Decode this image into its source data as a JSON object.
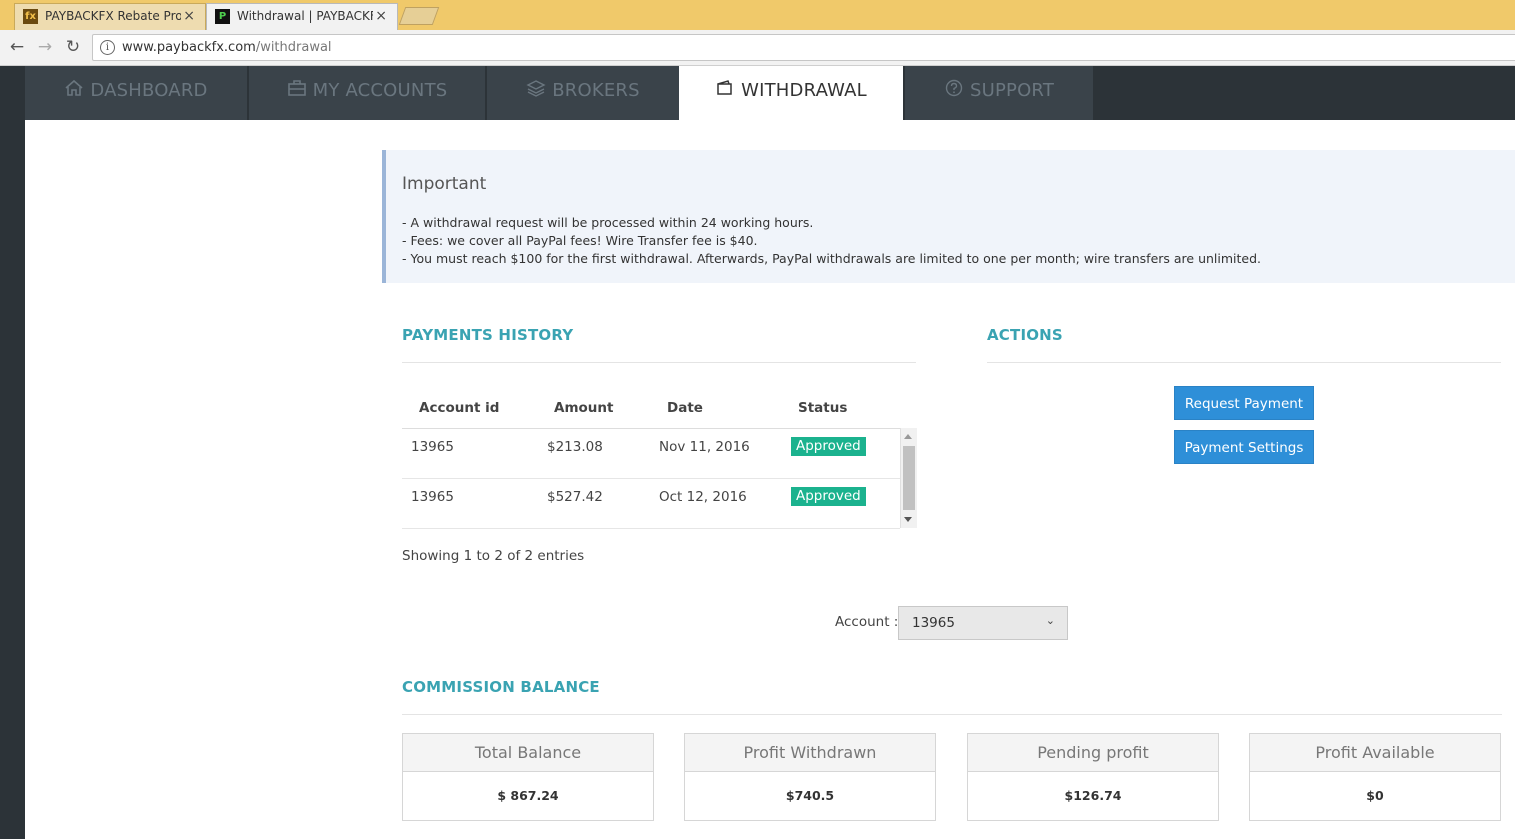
{
  "browser": {
    "tabs": [
      {
        "title": "PAYBACKFX Rebate Prog",
        "favicon": "fx"
      },
      {
        "title": "Withdrawal | PAYBACKFX",
        "favicon": "P"
      }
    ],
    "close_glyph": "×",
    "url_host": "www.paybackfx.com",
    "url_path": "/withdrawal"
  },
  "nav": {
    "items": [
      {
        "label": "DASHBOARD",
        "icon": "home-icon"
      },
      {
        "label": "MY ACCOUNTS",
        "icon": "briefcase-icon"
      },
      {
        "label": "BROKERS",
        "icon": "layers-icon"
      },
      {
        "label": "WITHDRAWAL",
        "icon": "wallet-icon",
        "active": true
      },
      {
        "label": "SUPPORT",
        "icon": "question-icon"
      }
    ]
  },
  "notice": {
    "title": "Important",
    "lines": [
      "- A withdrawal request will be processed within 24 working hours.",
      "- Fees: we cover all PayPal fees! Wire Transfer fee is $40.",
      "- You must reach $100 for the first withdrawal. Afterwards, PayPal withdrawals are limited to one per month; wire transfers are unlimited."
    ]
  },
  "payments": {
    "title": "PAYMENTS HISTORY",
    "columns": [
      "Account id",
      "Amount",
      "Date",
      "Status"
    ],
    "rows": [
      {
        "account": "13965",
        "amount": "$213.08",
        "date": "Nov 11, 2016",
        "status": "Approved"
      },
      {
        "account": "13965",
        "amount": "$527.42",
        "date": "Oct 12, 2016",
        "status": "Approved"
      }
    ],
    "info": "Showing 1 to 2 of 2 entries"
  },
  "actions": {
    "title": "ACTIONS",
    "request_label": "Request Payment",
    "settings_label": "Payment Settings"
  },
  "account_select": {
    "label": "Account :",
    "value": "13965"
  },
  "commission": {
    "title": "COMMISSION BALANCE",
    "cards": [
      {
        "label": "Total Balance",
        "value": "$ 867.24"
      },
      {
        "label": "Profit Withdrawn",
        "value": "$740.5"
      },
      {
        "label": "Pending profit",
        "value": "$126.74"
      },
      {
        "label": "Profit Available",
        "value": "$0"
      }
    ]
  },
  "colors": {
    "accent": "#3aa3b2",
    "button": "#2e8fd8",
    "approved": "#1bb28e",
    "nav_bg": "#2c3338"
  }
}
